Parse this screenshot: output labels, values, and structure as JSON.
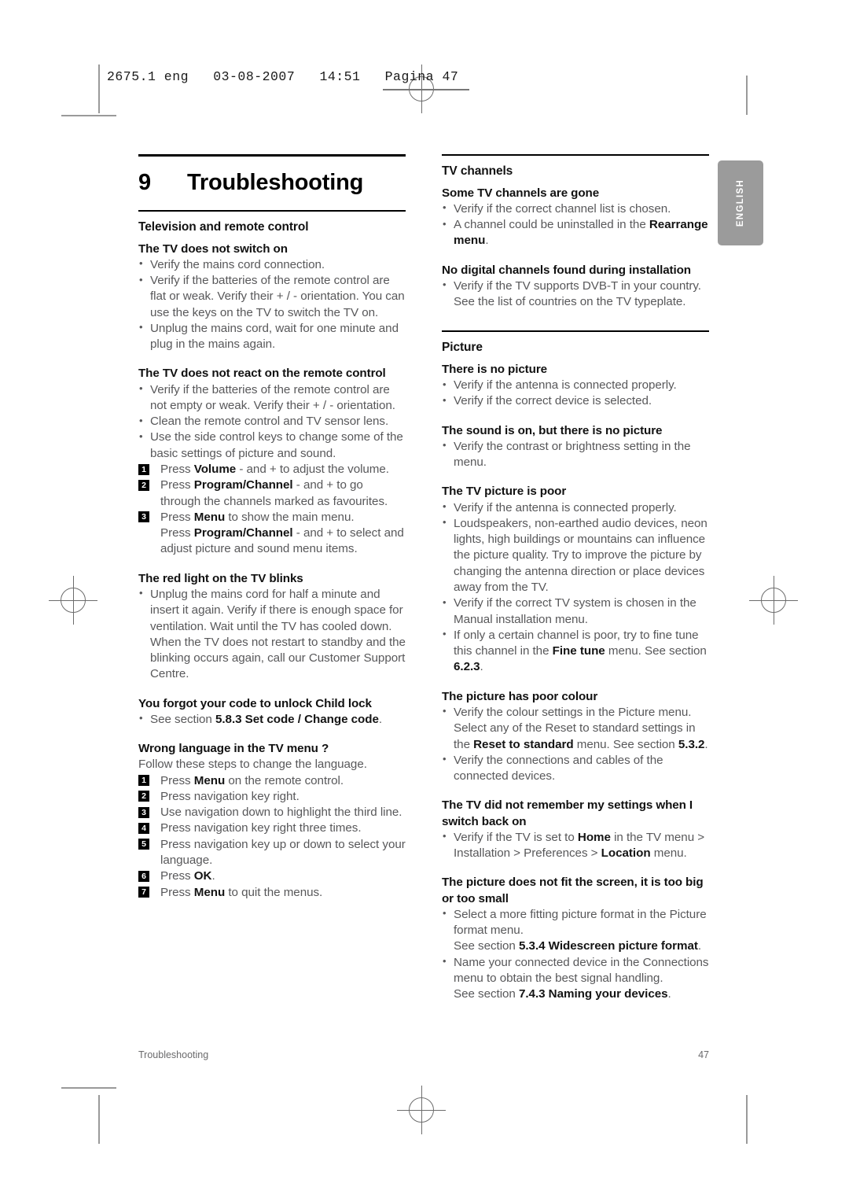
{
  "print_marks": {
    "slug_text": "2675.1 eng   03-08-2007   14:51   Pagina 47"
  },
  "language_tab": {
    "label": "ENGLISH"
  },
  "chapter": {
    "number": "9",
    "title": "Troubleshooting"
  },
  "left_column": {
    "section_heading": "Television and remote control",
    "blocks": [
      {
        "heading": "The TV does not switch on",
        "bullets": [
          "Verify the mains cord connection.",
          "Verify if the batteries of the remote control are flat or weak. Verify their + / - orientation. You can use the keys on the TV to switch the TV on.",
          "Unplug the mains cord, wait for one minute and plug in the mains again."
        ]
      },
      {
        "heading": "The TV does not react on the remote control",
        "bullets": [
          "Verify if the batteries of the remote control are not empty or weak. Verify their + / - orientation.",
          "Clean the remote control and TV sensor lens.",
          "Use the side control keys to change some of the basic settings of picture and sound."
        ],
        "steps": [
          "Press <b>Volume</b> - and + to adjust the volume.",
          "Press <b>Program/Channel</b> - and + to go through the channels marked as favourites.",
          "Press <b>Menu</b> to show the main menu.<br>Press <b>Program/Channel</b> - and + to select and adjust picture and sound menu items."
        ]
      },
      {
        "heading": "The red light on the TV blinks",
        "bullets": [
          "Unplug the mains cord for half a minute and insert it again. Verify if there is enough space for ventilation. Wait until the TV has cooled down. When the TV does not restart to standby and the blinking occurs again, call our Customer Support Centre."
        ]
      },
      {
        "heading": "You forgot your code to unlock Child lock",
        "bullets": [
          "See section <b>5.8.3 Set code / Change code</b>."
        ]
      },
      {
        "heading": "Wrong language in the TV menu ?",
        "intro": "Follow these steps to change the language.",
        "steps": [
          "Press <b>Menu</b> on the remote control.",
          "Press navigation key right.",
          "Use navigation down to highlight the third line.",
          "Press navigation key right three times.",
          "Press navigation key up or down to select your language.",
          "Press <b>OK</b>.",
          "Press <b>Menu</b> to quit the menus."
        ]
      }
    ]
  },
  "right_column": {
    "sections": [
      {
        "section_heading": "TV channels",
        "blocks": [
          {
            "heading": "Some TV channels are gone",
            "bullets": [
              "Verify if the correct channel list is chosen.",
              "A channel could be uninstalled in the <b>Rearrange menu</b>."
            ]
          },
          {
            "heading": "No digital channels found during installation",
            "bullets": [
              "Verify if the TV supports DVB-T in your country. See the list of countries on the TV typeplate."
            ]
          }
        ]
      },
      {
        "section_heading": "Picture",
        "blocks": [
          {
            "heading": "There is no picture",
            "bullets": [
              "Verify if the antenna is connected properly.",
              "Verify if the correct device is selected."
            ]
          },
          {
            "heading": "The sound is on, but there is no picture",
            "bullets": [
              "Verify the contrast or brightness setting in the menu."
            ]
          },
          {
            "heading": "The TV picture is poor",
            "bullets": [
              "Verify if the antenna is connected properly.",
              "Loudspeakers, non-earthed audio devices, neon lights, high buildings or mountains can influence the picture quality. Try to improve the picture by changing the antenna direction or place devices away from the TV.",
              "Verify if the correct TV system is chosen in the Manual installation menu.",
              "If only a certain channel is poor, try to fine tune this channel in the <b>Fine tune</b> menu. See section <b>6.2.3</b>."
            ]
          },
          {
            "heading": "The picture has poor colour",
            "bullets": [
              "Verify the colour settings in the Picture menu. Select any of the Reset to standard settings in the <b>Reset to standard</b> menu. See section <b>5.3.2</b>.",
              "Verify the connections and cables of the connected devices."
            ]
          },
          {
            "heading": "The TV did not remember my settings when I switch back on",
            "bullets": [
              "Verify if the TV is set to <b>Home</b> in the TV menu &gt; Installation &gt; Preferences &gt; <b>Location</b> menu."
            ]
          },
          {
            "heading": "The picture does not fit the screen, it is too big or too small",
            "bullets": [
              "Select a more fitting picture format in the Picture format menu.<br>See section <b>5.3.4 Widescreen picture format</b>.",
              "Name your connected device in the Connections menu to obtain the best signal handling.<br>See section <b>7.4.3 Naming your devices</b>."
            ]
          }
        ]
      }
    ]
  },
  "footer": {
    "left": "Troubleshooting",
    "right": "47"
  }
}
